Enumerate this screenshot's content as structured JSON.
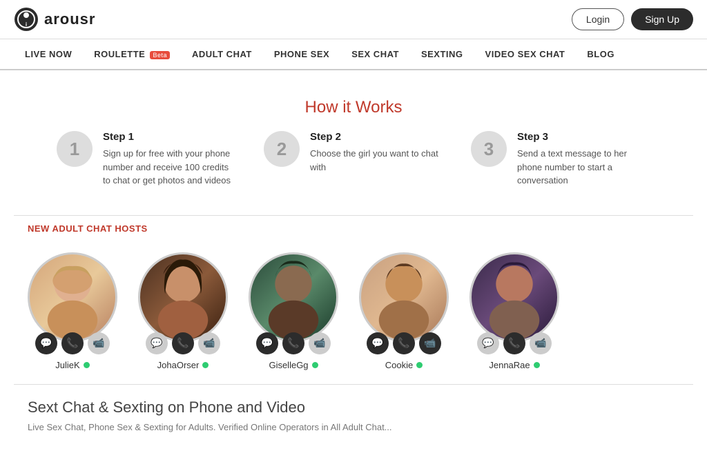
{
  "header": {
    "logo_text": "arousr",
    "login_label": "Login",
    "signup_label": "Sign Up"
  },
  "nav": {
    "items": [
      {
        "label": "LIVE NOW",
        "badge": null
      },
      {
        "label": "ROULETTE",
        "badge": "Beta"
      },
      {
        "label": "ADULT CHAT",
        "badge": null
      },
      {
        "label": "PHONE SEX",
        "badge": null
      },
      {
        "label": "SEX CHAT",
        "badge": null
      },
      {
        "label": "SEXTING",
        "badge": null
      },
      {
        "label": "VIDEO SEX CHAT",
        "badge": null
      },
      {
        "label": "BLOG",
        "badge": null
      }
    ]
  },
  "how_it_works": {
    "title": "How it Works",
    "steps": [
      {
        "number": "1",
        "title": "Step 1",
        "description": "Sign up for free with your phone number and receive 100 credits to chat or get photos and videos"
      },
      {
        "number": "2",
        "title": "Step 2",
        "description": "Choose the girl you want to chat with"
      },
      {
        "number": "3",
        "title": "Step 3",
        "description": "Send a text message to her phone number to start a conversation"
      }
    ]
  },
  "hosts_section": {
    "title": "NEW ADULT CHAT HOSTS",
    "hosts": [
      {
        "name": "JulieK",
        "online": true,
        "avatar_class": "avatar-1"
      },
      {
        "name": "JohaOrser",
        "online": true,
        "avatar_class": "avatar-2"
      },
      {
        "name": "GiselleGg",
        "online": true,
        "avatar_class": "avatar-3"
      },
      {
        "name": "Cookie",
        "online": true,
        "avatar_class": "avatar-4"
      },
      {
        "name": "JennaRae",
        "online": true,
        "avatar_class": "avatar-5"
      }
    ]
  },
  "bottom": {
    "title": "Sext Chat & Sexting on Phone and Video",
    "description": "Live Sex Chat, Phone Sex & Sexting for Adults. Verified Online Operators in All Adult Chat..."
  },
  "icons": {
    "chat": "💬",
    "phone": "📞",
    "video": "📹"
  }
}
